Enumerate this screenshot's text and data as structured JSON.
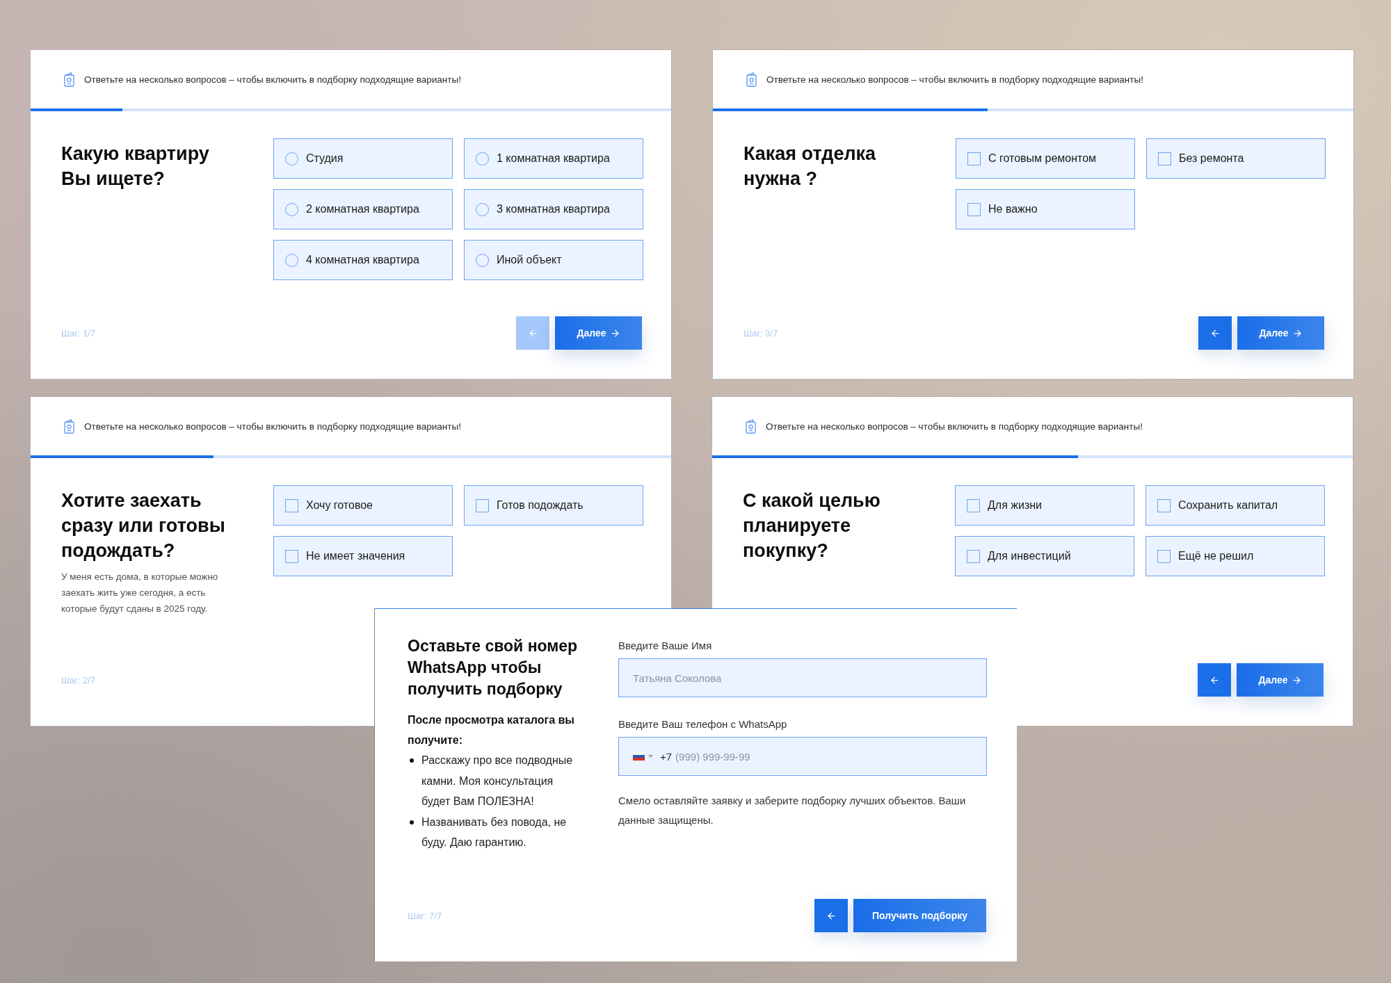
{
  "quiz_cards": [
    {
      "kind": "radio",
      "header": "Ответьте на несколько вопросов – чтобы включить в подборку подходящие варианты!",
      "progress": {
        "level": 0.143
      },
      "question": "Какую квартиру Вы ищете?",
      "options": [
        {
          "label": "Студия",
          "selected": false
        },
        {
          "label": "1 комнатная квартира",
          "selected": false
        },
        {
          "label": "2 комнатная квартира",
          "selected": false
        },
        {
          "label": "3 комнатная квартира",
          "selected": false
        },
        {
          "label": "4 комнатная квартира",
          "selected": false
        },
        {
          "label": "Иной объект",
          "selected": false
        }
      ],
      "step": "Шаг: 1/7",
      "back_button": {
        "disabled": true
      },
      "next_button": "Далее"
    },
    {
      "kind": "checkbox",
      "header": "Ответьте на несколько вопросов – чтобы включить в подборку подходящие варианты!",
      "progress": {
        "level": 0.429
      },
      "question": "Какая отделка нужна ?",
      "options": [
        {
          "label": "С готовым ремонтом",
          "checked": false
        },
        {
          "label": "Без ремонта",
          "checked": false
        },
        {
          "label": "Не важно",
          "checked": false
        }
      ],
      "step": "Шаг: 3/7",
      "back_button": {
        "disabled": false
      },
      "next_button": "Далее"
    },
    {
      "kind": "checkbox",
      "header": "Ответьте на несколько вопросов – чтобы включить в подборку подходящие варианты!",
      "progress": {
        "level": 0.286
      },
      "question": "Хотите заехать сразу или готовы подождать?",
      "description": "У меня есть дома, в которые можно заехать жить уже сегодня, а есть которые будут сданы в 2025 году.",
      "options": [
        {
          "label": "Хочу готовое",
          "checked": false
        },
        {
          "label": "Готов подождать",
          "checked": false
        },
        {
          "label": "Не имеет значения",
          "checked": false
        }
      ],
      "step": "Шаг: 2/7"
    },
    {
      "kind": "checkbox",
      "header": "Ответьте на несколько вопросов – чтобы включить в подборку подходящие варианты!",
      "progress": {
        "level": 0.571
      },
      "question": "С какой целью планируете покупку?",
      "options": [
        {
          "label": "Для жизни",
          "checked": false
        },
        {
          "label": "Сохранить капитал",
          "checked": false
        },
        {
          "label": "Для инвестиций",
          "checked": false
        },
        {
          "label": "Ещё не решил",
          "checked": false
        }
      ],
      "back_button": {
        "disabled": false
      },
      "next_button": "Далее"
    }
  ],
  "contact_card": {
    "title": "Оставьте свой номер WhatsApp чтобы получить подборку",
    "benefits_heading": "После просмотра каталога вы получите:",
    "benefits": [
      "Расскажу про все подводные камни. Моя консультация будет Вам ПОЛЕЗНА!",
      "Названивать без повода, не буду. Даю гарантию."
    ],
    "fields": [
      {
        "kind": "text",
        "label": "Введите Ваше Имя",
        "placeholder": "Татьяна Соколова"
      },
      {
        "kind": "phone",
        "label": "Введите Ваш телефон с WhatsApp",
        "value": "+7",
        "placeholder": "(999) 999-99-99"
      }
    ],
    "note": "Смело оставляйте заявку и заберите подборку лучших объектов. Ваши данные защищены.",
    "step": "Шаг: 7/7",
    "back_button": {
      "disabled": false
    },
    "submit_button": "Получить подборку"
  }
}
